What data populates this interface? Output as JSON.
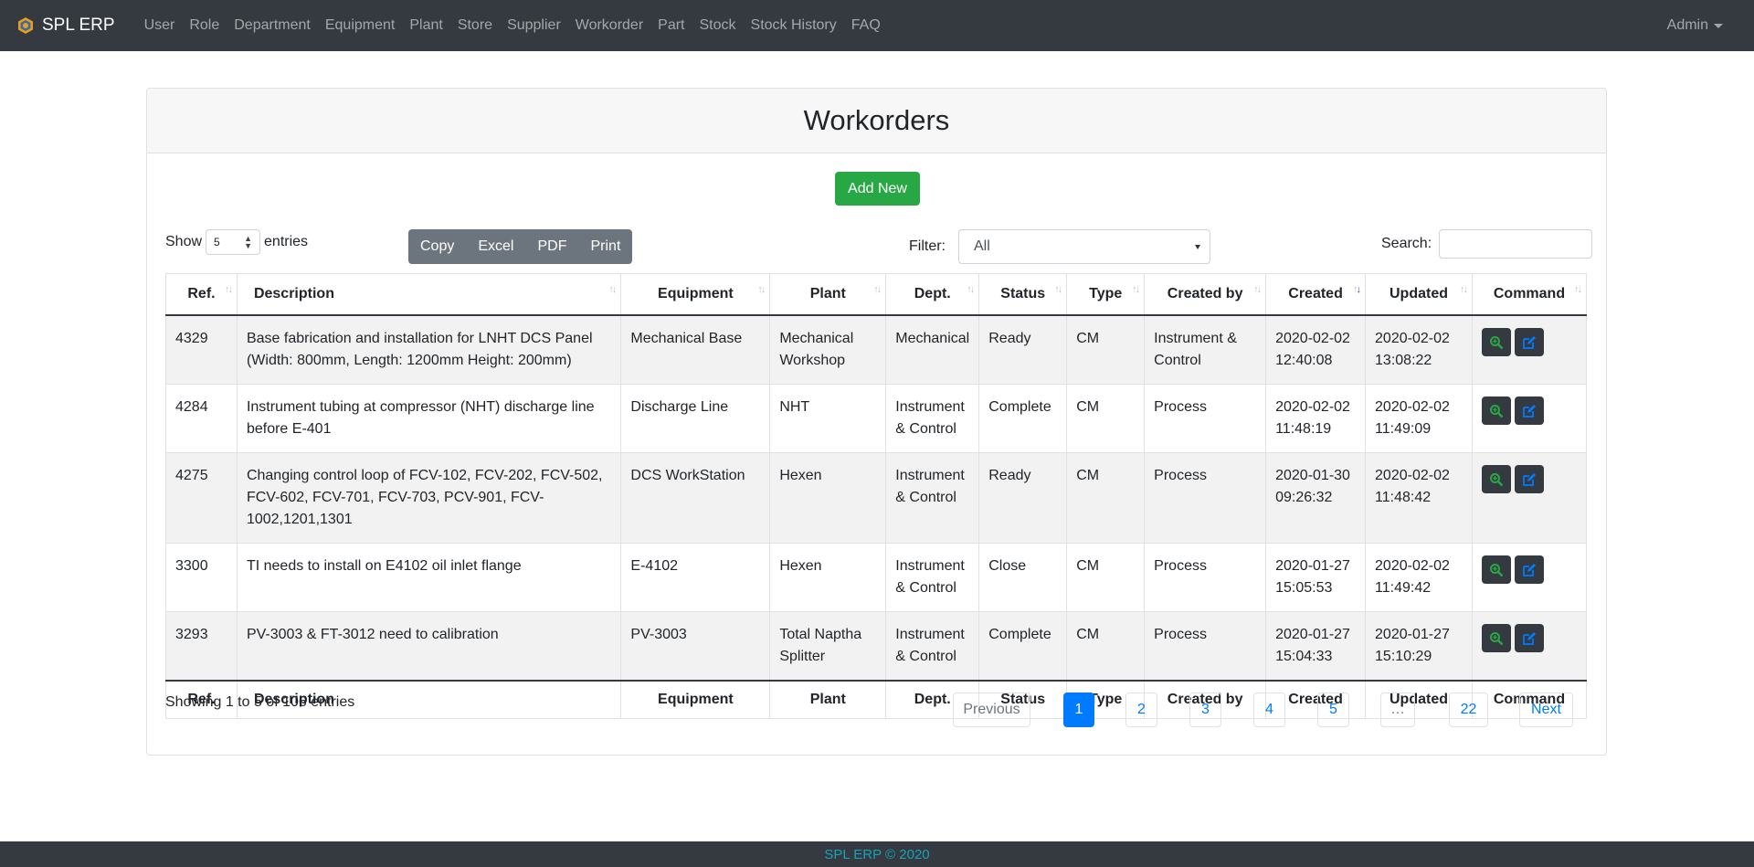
{
  "navbar": {
    "brand": "SPL ERP",
    "items": [
      "User",
      "Role",
      "Department",
      "Equipment",
      "Plant",
      "Store",
      "Supplier",
      "Workorder",
      "Part",
      "Stock",
      "Stock History",
      "FAQ"
    ],
    "user": "Admin"
  },
  "page": {
    "title": "Workorders",
    "add_button": "Add New"
  },
  "controls": {
    "show_label": "Show",
    "show_value": "5",
    "entries_label": "entries",
    "export_buttons": [
      "Copy",
      "Excel",
      "PDF",
      "Print"
    ],
    "filter_label": "Filter:",
    "filter_value": "All",
    "search_label": "Search:"
  },
  "table": {
    "columns": [
      "Ref.",
      "Description",
      "Equipment",
      "Plant",
      "Dept.",
      "Status",
      "Type",
      "Created by",
      "Created",
      "Updated",
      "Command"
    ],
    "rows": [
      {
        "ref": "4329",
        "description": "Base fabrication and installation for LNHT DCS Panel (Width: 800mm, Length: 1200mm Height: 200mm)",
        "equipment": "Mechanical Base",
        "plant": "Mechanical Workshop",
        "dept": "Mechanical",
        "status": "Ready",
        "type": "CM",
        "created_by": "Instrument & Control",
        "created": "2020-02-02 12:40:08",
        "updated": "2020-02-02 13:08:22"
      },
      {
        "ref": "4284",
        "description": "Instrument tubing at compressor (NHT) discharge line before E-401",
        "equipment": "Discharge Line",
        "plant": "NHT",
        "dept": "Instrument & Control",
        "status": "Complete",
        "type": "CM",
        "created_by": "Process",
        "created": "2020-02-02 11:48:19",
        "updated": "2020-02-02 11:49:09"
      },
      {
        "ref": "4275",
        "description": "Changing control loop of FCV-102, FCV-202, FCV-502, FCV-602, FCV-701, FCV-703, PCV-901, FCV-1002,1201,1301",
        "equipment": "DCS WorkStation",
        "plant": "Hexen",
        "dept": "Instrument & Control",
        "status": "Ready",
        "type": "CM",
        "created_by": "Process",
        "created": "2020-01-30 09:26:32",
        "updated": "2020-02-02 11:48:42"
      },
      {
        "ref": "3300",
        "description": "TI needs to install on E4102 oil inlet flange",
        "equipment": "E-4102",
        "plant": "Hexen",
        "dept": "Instrument & Control",
        "status": "Close",
        "type": "CM",
        "created_by": "Process",
        "created": "2020-01-27 15:05:53",
        "updated": "2020-02-02 11:49:42"
      },
      {
        "ref": "3293",
        "description": "PV-3003 & FT-3012 need to calibration",
        "equipment": "PV-3003",
        "plant": "Total Naptha Splitter",
        "dept": "Instrument & Control",
        "status": "Complete",
        "type": "CM",
        "created_by": "Process",
        "created": "2020-01-27 15:04:33",
        "updated": "2020-01-27 15:10:29"
      }
    ]
  },
  "info": "Showing 1 to 5 of 106 entries",
  "pagination": {
    "previous": "Previous",
    "pages": [
      "1",
      "2",
      "3",
      "4",
      "5",
      "…",
      "22"
    ],
    "next": "Next",
    "active": "1"
  },
  "footer": "SPL ERP © 2020",
  "colors": {
    "navbar": "#343a40",
    "add_button": "#28a745",
    "export_group": "#6c757d",
    "view_icon": "#28a745",
    "edit_icon": "#007bff",
    "active_page": "#007bff",
    "footer_text": "#17a2b8"
  },
  "icons": {
    "brand": "gear-logo-icon",
    "view": "zoom-in-icon",
    "edit": "edit-icon",
    "sort": "sort-arrows-icon"
  }
}
